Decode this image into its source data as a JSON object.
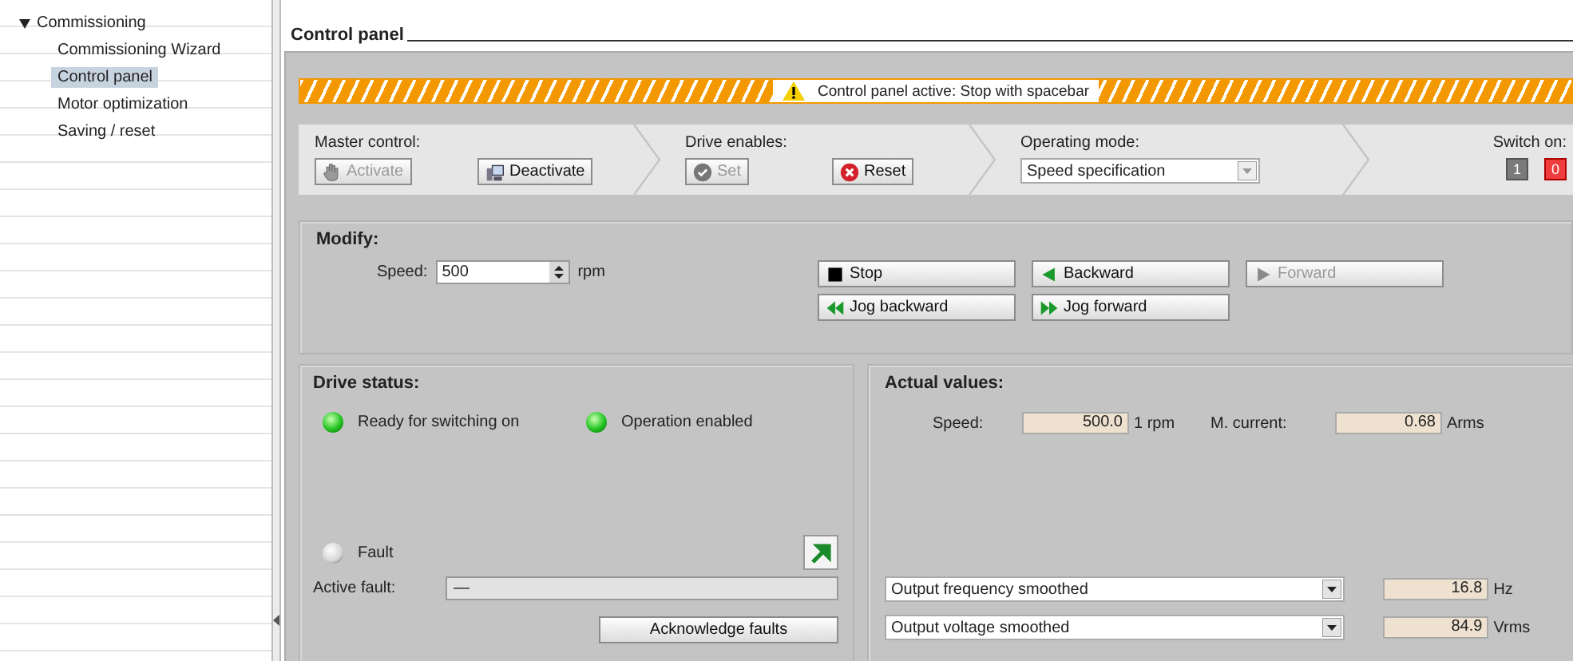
{
  "sidebar": {
    "items": [
      {
        "label": "Commissioning",
        "expanded": true,
        "children": [
          {
            "label": "Commissioning Wizard",
            "selected": false
          },
          {
            "label": "Control panel",
            "selected": true
          },
          {
            "label": "Motor optimization",
            "selected": false
          },
          {
            "label": "Saving / reset",
            "selected": false
          }
        ]
      }
    ]
  },
  "header": {
    "title": "Control panel"
  },
  "banner": {
    "text": "Control panel active: Stop with spacebar"
  },
  "steps": [
    {
      "label": "Master control:",
      "kind": "buttons",
      "buttons": [
        {
          "label": "Activate",
          "kind": "hand",
          "disabled": true
        },
        {
          "label": "Deactivate",
          "kind": "computer",
          "disabled": false
        }
      ]
    },
    {
      "label": "Drive enables:",
      "kind": "buttons",
      "buttons": [
        {
          "label": "Set",
          "kind": "check",
          "disabled": true
        },
        {
          "label": "Reset",
          "kind": "error",
          "disabled": false
        }
      ]
    },
    {
      "label": "Operating mode:",
      "kind": "dropdown",
      "value": "Speed specification"
    },
    {
      "label": "Switch on:",
      "kind": "switch",
      "switches": [
        {
          "label": "1",
          "on": false
        },
        {
          "label": "0",
          "on": true
        }
      ]
    }
  ],
  "modify": {
    "title": "Modify:",
    "speed_label": "Speed:",
    "speed_value": "500",
    "unit": "rpm",
    "buttons": [
      [
        {
          "label": "Stop",
          "kind": "stop",
          "disabled": false
        },
        {
          "label": "Backward",
          "kind": "backward",
          "disabled": false
        },
        {
          "label": "Forward",
          "kind": "forward",
          "disabled": true
        }
      ],
      [
        {
          "label": "Jog backward",
          "kind": "jog_backward",
          "disabled": false
        },
        {
          "label": "Jog forward",
          "kind": "jog_forward",
          "disabled": false
        }
      ]
    ]
  },
  "drive_status": {
    "title": "Drive status:",
    "indicators": [
      {
        "label": "Ready for switching on",
        "on": true
      },
      {
        "label": "Operation enabled",
        "on": true
      }
    ],
    "fault": {
      "label": "Fault",
      "on": false
    },
    "active_fault_label": "Active fault:",
    "active_fault_value": "—",
    "acknowledge": "Acknowledge faults"
  },
  "actual_values": {
    "title": "Actual values:",
    "fields": [
      {
        "label": "Speed:",
        "value": "500.0",
        "unit": "1 rpm"
      },
      {
        "label": "M. current:",
        "value": "0.68",
        "unit": "Arms"
      }
    ],
    "selectors": [
      {
        "value": "Output frequency smoothed",
        "reading": "16.8",
        "unit": "Hz"
      },
      {
        "value": "Output voltage smoothed",
        "reading": "84.9",
        "unit": "Vrms"
      }
    ]
  }
}
